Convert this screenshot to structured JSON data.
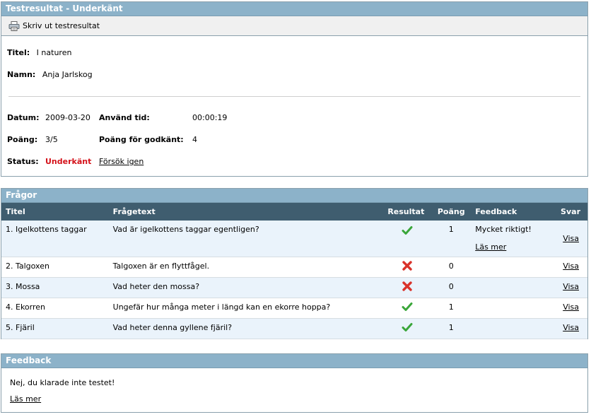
{
  "result_panel": {
    "title": "Testresultat - Underkänt",
    "print_label": "Skriv ut testresultat",
    "titel_label": "Titel:",
    "titel_value": "I naturen",
    "namn_label": "Namn:",
    "namn_value": "Anja Jarlskog",
    "datum_label": "Datum:",
    "datum_value": "2009-03-20",
    "tid_label": "Använd tid:",
    "tid_value": "00:00:19",
    "poang_label": "Poäng:",
    "poang_value": "3/5",
    "godkant_label": "Poäng för godkänt:",
    "godkant_value": "4",
    "status_label": "Status:",
    "status_value": "Underkänt",
    "retry_label": "Försök igen",
    "status_color": "#d4121a"
  },
  "questions_panel": {
    "title": "Frågor",
    "columns": [
      "Titel",
      "Frågetext",
      "Resultat",
      "Poäng",
      "Feedback",
      "Svar"
    ],
    "rows": [
      {
        "titel": "1. Igelkottens taggar",
        "text": "Vad är igelkottens taggar egentligen?",
        "result_icon": "check-icon",
        "poang": "1",
        "feedback": "Mycket riktigt!",
        "feedback_link": "Läs mer",
        "svar": "Visa"
      },
      {
        "titel": "2. Talgoxen",
        "text": "Talgoxen är en flyttfågel.",
        "result_icon": "cross-icon",
        "poang": "0",
        "feedback": "",
        "feedback_link": "",
        "svar": "Visa"
      },
      {
        "titel": "3. Mossa",
        "text": "Vad heter den mossa?",
        "result_icon": "cross-icon",
        "poang": "0",
        "feedback": "",
        "feedback_link": "",
        "svar": "Visa"
      },
      {
        "titel": "4. Ekorren",
        "text": "Ungefär hur många meter i längd kan en ekorre hoppa?",
        "result_icon": "check-icon",
        "poang": "1",
        "feedback": "",
        "feedback_link": "",
        "svar": "Visa"
      },
      {
        "titel": "5. Fjäril",
        "text": "Vad heter denna gyllene fjäril?",
        "result_icon": "check-icon",
        "poang": "1",
        "feedback": "",
        "feedback_link": "",
        "svar": "Visa"
      }
    ]
  },
  "feedback_panel": {
    "title": "Feedback",
    "message": "Nej, du klarade inte testet!",
    "link": "Läs mer"
  },
  "icons": {
    "print": "printer-icon",
    "correct": "check-icon",
    "wrong": "cross-icon"
  },
  "colors": {
    "panel_header": "#8cb2c9",
    "table_header": "#3f5d6f",
    "alt_row": "#eaf3fb",
    "check": "#3aa63a",
    "cross": "#d9322a"
  }
}
